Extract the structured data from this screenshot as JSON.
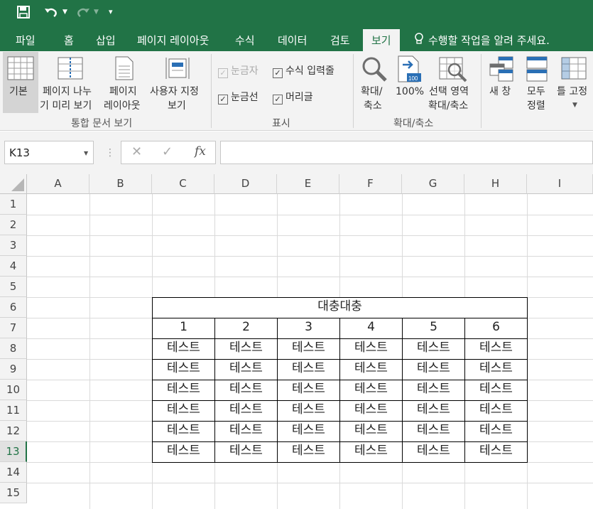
{
  "qat": {
    "save_icon": "save-icon",
    "undo_icon": "undo-icon",
    "redo_icon": "redo-icon",
    "customize_icon": "customize-icon"
  },
  "tabs": [
    {
      "label": "파일"
    },
    {
      "label": "홈"
    },
    {
      "label": "삽입"
    },
    {
      "label": "페이지 레이아웃"
    },
    {
      "label": "수식"
    },
    {
      "label": "데이터"
    },
    {
      "label": "검토"
    },
    {
      "label": "보기"
    }
  ],
  "tell_me": "수행할 작업을 알려 주세요.",
  "ribbon": {
    "normal": "기본",
    "page_break_1": "페이지 나누",
    "page_break_2": "기 미리 보기",
    "page_layout_1": "페이지",
    "page_layout_2": "레이아웃",
    "custom_view_1": "사용자 지정",
    "custom_view_2": "보기",
    "group_views": "통합 문서 보기",
    "ruler": "눈금자",
    "formula_bar": "수식 입력줄",
    "gridlines": "눈금선",
    "headings": "머리글",
    "group_show": "표시",
    "zoom_1": "확대/",
    "zoom_2": "축소",
    "zoom100": "100%",
    "zoom_sel_1": "선택 영역",
    "zoom_sel_2": "확대/축소",
    "group_zoom": "확대/축소",
    "new_window": "새 창",
    "arrange_1": "모두",
    "arrange_2": "정렬",
    "freeze": "틀 고정"
  },
  "namebox": "K13",
  "formula_value": "",
  "columns": [
    "A",
    "B",
    "C",
    "D",
    "E",
    "F",
    "G",
    "H",
    "I"
  ],
  "rows": [
    "1",
    "2",
    "3",
    "4",
    "5",
    "6",
    "7",
    "8",
    "9",
    "10",
    "11",
    "12",
    "13",
    "14",
    "15"
  ],
  "table": {
    "title": "대충대충",
    "headers": [
      "1",
      "2",
      "3",
      "4",
      "5",
      "6"
    ],
    "rows": [
      [
        "테스트",
        "테스트",
        "테스트",
        "테스트",
        "테스트",
        "테스트"
      ],
      [
        "테스트",
        "테스트",
        "테스트",
        "테스트",
        "테스트",
        "테스트"
      ],
      [
        "테스트",
        "테스트",
        "테스트",
        "테스트",
        "테스트",
        "테스트"
      ],
      [
        "테스트",
        "테스트",
        "테스트",
        "테스트",
        "테스트",
        "테스트"
      ],
      [
        "테스트",
        "테스트",
        "테스트",
        "테스트",
        "테스트",
        "테스트"
      ],
      [
        "테스트",
        "테스트",
        "테스트",
        "테스트",
        "테스트",
        "테스트"
      ]
    ]
  },
  "colors": {
    "accent": "#217346"
  }
}
